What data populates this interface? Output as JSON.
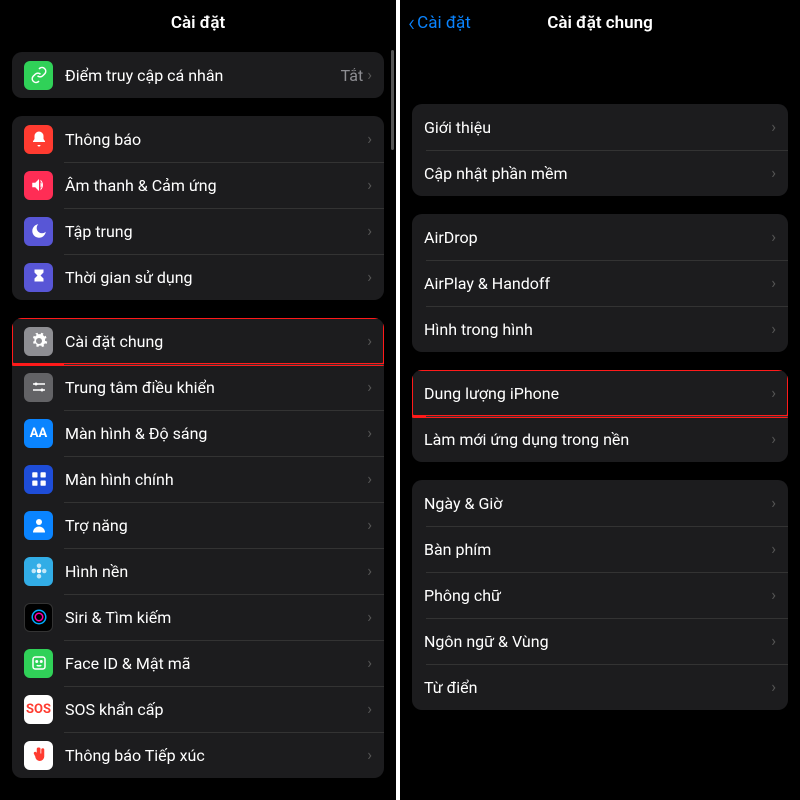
{
  "left": {
    "title": "Cài đặt",
    "hotspot": {
      "label": "Điểm truy cập cá nhân",
      "value": "Tắt"
    },
    "group2": [
      {
        "key": "notify",
        "label": "Thông báo",
        "icon": "bell",
        "cls": "ic-red"
      },
      {
        "key": "sound",
        "label": "Âm thanh & Cảm ứng",
        "icon": "speaker",
        "cls": "ic-pink"
      },
      {
        "key": "focus",
        "label": "Tập trung",
        "icon": "moon",
        "cls": "ic-indigo"
      },
      {
        "key": "screentime",
        "label": "Thời gian sử dụng",
        "icon": "hourglass",
        "cls": "ic-indigo"
      }
    ],
    "group3": [
      {
        "key": "general",
        "label": "Cài đặt chung",
        "icon": "gear",
        "cls": "ic-gear",
        "highlight": true
      },
      {
        "key": "control",
        "label": "Trung tâm điều khiển",
        "icon": "sliders",
        "cls": "ic-grey2"
      },
      {
        "key": "display",
        "label": "Màn hình & Độ sáng",
        "icon": "aa",
        "cls": "ic-blue"
      },
      {
        "key": "home",
        "label": "Màn hình chính",
        "icon": "grid",
        "cls": "ic-dblue"
      },
      {
        "key": "access",
        "label": "Trợ năng",
        "icon": "person",
        "cls": "ic-blue"
      },
      {
        "key": "wallpaper",
        "label": "Hình nền",
        "icon": "flower",
        "cls": "ic-cyan"
      },
      {
        "key": "siri",
        "label": "Siri & Tìm kiếm",
        "icon": "siri",
        "cls": "ic-black"
      },
      {
        "key": "faceid",
        "label": "Face ID & Mật mã",
        "icon": "face",
        "cls": "ic-facegr"
      },
      {
        "key": "sos",
        "label": "SOS khẩn cấp",
        "icon": "sos",
        "cls": "ic-sos"
      },
      {
        "key": "exposure",
        "label": "Thông báo Tiếp xúc",
        "icon": "hand",
        "cls": "ic-hand"
      }
    ]
  },
  "right": {
    "back": "Cài đặt",
    "title": "Cài đặt chung",
    "group1": [
      {
        "key": "about",
        "label": "Giới thiệu"
      },
      {
        "key": "update",
        "label": "Cập nhật phần mềm"
      }
    ],
    "group2": [
      {
        "key": "airdrop",
        "label": "AirDrop"
      },
      {
        "key": "airplay",
        "label": "AirPlay & Handoff"
      },
      {
        "key": "pip",
        "label": "Hình trong hình"
      }
    ],
    "group3": [
      {
        "key": "storage",
        "label": "Dung lượng iPhone",
        "highlight": true
      },
      {
        "key": "bgapp",
        "label": "Làm mới ứng dụng trong nền"
      }
    ],
    "group4": [
      {
        "key": "date",
        "label": "Ngày & Giờ"
      },
      {
        "key": "kbd",
        "label": "Bàn phím"
      },
      {
        "key": "font",
        "label": "Phông chữ"
      },
      {
        "key": "lang",
        "label": "Ngôn ngữ & Vùng"
      },
      {
        "key": "dict",
        "label": "Từ điển"
      }
    ]
  },
  "icons_text": {
    "aa": "AA",
    "sos": "SOS"
  }
}
